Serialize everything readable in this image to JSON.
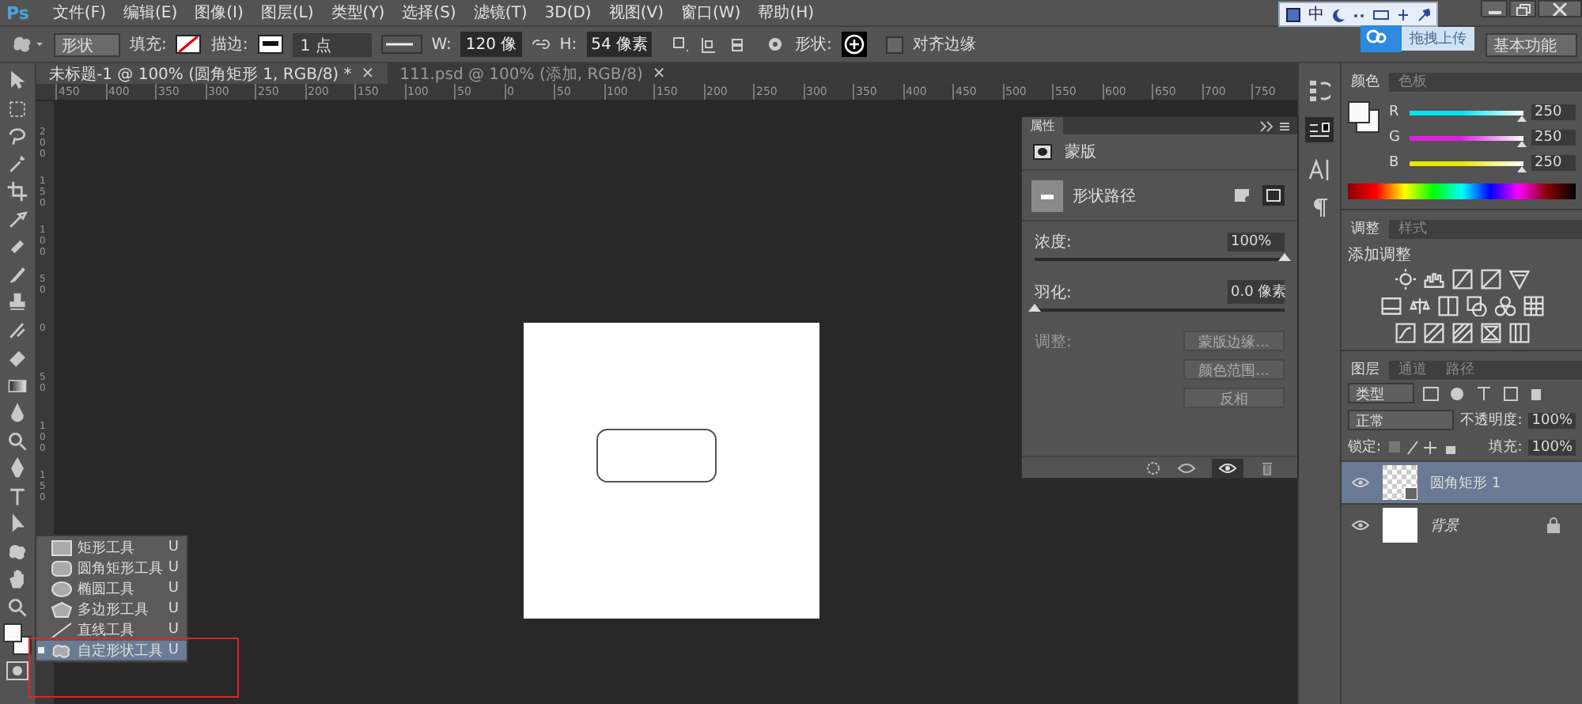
{
  "logo": "Ps",
  "menu": [
    "文件(F)",
    "编辑(E)",
    "图像(I)",
    "图层(L)",
    "类型(Y)",
    "选择(S)",
    "滤镜(T)",
    "3D(D)",
    "视图(V)",
    "窗口(W)",
    "帮助(H)"
  ],
  "ime_toolbar": {
    "lang": "中"
  },
  "upload_button": "拖拽上传",
  "options_bar": {
    "mode": "形状",
    "fill_label": "填充:",
    "stroke_label": "描边:",
    "stroke_width": "1 点",
    "w_label": "W:",
    "w_value": "120 像",
    "h_label": "H:",
    "h_value": "54 像素",
    "shape_label": "形状:",
    "align_edges": {
      "label": "对齐边缘",
      "checked": false
    },
    "workspace": "基本功能"
  },
  "tabs": [
    {
      "label": "未标题-1 @ 100% (圆角矩形 1, RGB/8) *",
      "selected": true,
      "close": "×"
    },
    {
      "label": "111.psd @ 100% (添加, RGB/8)",
      "selected": false,
      "close": "×"
    }
  ],
  "ruler": {
    "horizontal": [
      "450",
      "400",
      "350",
      "300",
      "250",
      "200",
      "150",
      "100",
      "50",
      "0",
      "50",
      "100",
      "150",
      "200",
      "250",
      "300",
      "350",
      "400",
      "450",
      "500",
      "550",
      "600",
      "650",
      "700",
      "750"
    ],
    "vertical": [
      "200",
      "150",
      "100",
      "50",
      "0",
      "50",
      "100",
      "150"
    ]
  },
  "properties": {
    "title": "属性",
    "section": "蒙版",
    "shape_label": "形状路径",
    "density": {
      "label": "浓度:",
      "value": "100%",
      "level": 1
    },
    "feather": {
      "label": "羽化:",
      "value": "0.0 像素",
      "level": 0
    },
    "refine_label": "调整:",
    "buttons": [
      {
        "label": "蒙版边缘...",
        "disabled": true
      },
      {
        "label": "颜色范围...",
        "disabled": true
      },
      {
        "label": "反相",
        "disabled": true
      }
    ]
  },
  "color_panel": {
    "tabs": [
      {
        "label": "颜色",
        "selected": true
      },
      {
        "label": "色板",
        "selected": false
      }
    ],
    "channels": [
      {
        "name": "R",
        "value": "250",
        "level": 0.98,
        "color": "#00e5ee"
      },
      {
        "name": "G",
        "value": "250",
        "level": 0.98,
        "color": "#e020e0"
      },
      {
        "name": "B",
        "value": "250",
        "level": 0.98,
        "color": "#e8e800"
      }
    ]
  },
  "adjustments": {
    "tabs": [
      {
        "label": "调整",
        "selected": true
      },
      {
        "label": "样式",
        "selected": false
      }
    ],
    "title": "添加调整"
  },
  "layers_panel": {
    "tabs": [
      {
        "label": "图层",
        "selected": true
      },
      {
        "label": "通道",
        "selected": false
      },
      {
        "label": "路径",
        "selected": false
      }
    ],
    "filter": "类型",
    "blend_mode": "正常",
    "opacity_label": "不透明度:",
    "opacity": "100%",
    "lock_label": "锁定:",
    "fill_label": "填充:",
    "fill": "100%",
    "layers": [
      {
        "name": "圆角矩形 1",
        "kind": "shape",
        "selected": true,
        "visible": true,
        "locked": false
      },
      {
        "name": "背景",
        "kind": "background",
        "selected": false,
        "visible": true,
        "locked": true
      }
    ]
  },
  "tool_flyout": {
    "items": [
      {
        "label": "矩形工具",
        "shortcut": "U",
        "kind": "rect",
        "selected": false
      },
      {
        "label": "圆角矩形工具",
        "shortcut": "U",
        "kind": "rounded",
        "selected": false
      },
      {
        "label": "椭圆工具",
        "shortcut": "U",
        "kind": "ellipse",
        "selected": false
      },
      {
        "label": "多边形工具",
        "shortcut": "U",
        "kind": "polygon",
        "selected": false
      },
      {
        "label": "直线工具",
        "shortcut": "U",
        "kind": "line",
        "selected": false
      },
      {
        "label": "自定形状工具",
        "shortcut": "U",
        "kind": "custom",
        "selected": true
      }
    ]
  }
}
